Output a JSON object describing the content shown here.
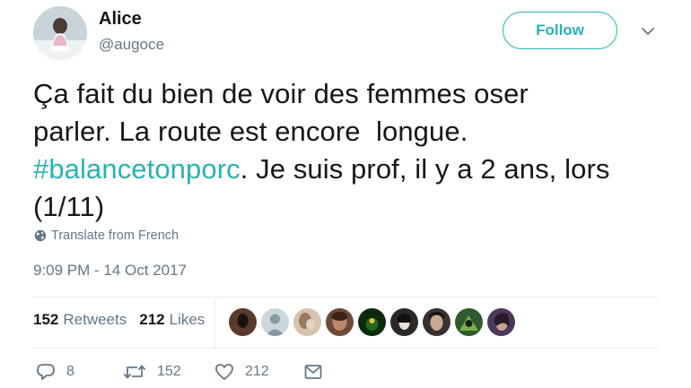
{
  "user": {
    "name": "Alice",
    "handle": "@augoce"
  },
  "follow_button": {
    "label": "Follow"
  },
  "tweet": {
    "lines": [
      {
        "text": "Ça fait du bien de voir des femmes oser"
      },
      {
        "text": "parler. La route est encore  longue."
      },
      {
        "hashtag": "#balancetonporc",
        "rest": ". Je suis prof, il y a 2 ans, lors"
      },
      {
        "text": "(1/11)"
      }
    ],
    "translate_label": "Translate from French",
    "timestamp": "9:09 PM - 14 Oct 2017"
  },
  "stats": {
    "retweets_count": "152",
    "retweets_label": "Retweets",
    "likes_count": "212",
    "likes_label": "Likes"
  },
  "actions": {
    "reply_count": "8",
    "retweet_count": "152",
    "like_count": "212"
  },
  "colors": {
    "accent": "#29b2b2",
    "muted": "#657786",
    "text": "#14171a"
  }
}
